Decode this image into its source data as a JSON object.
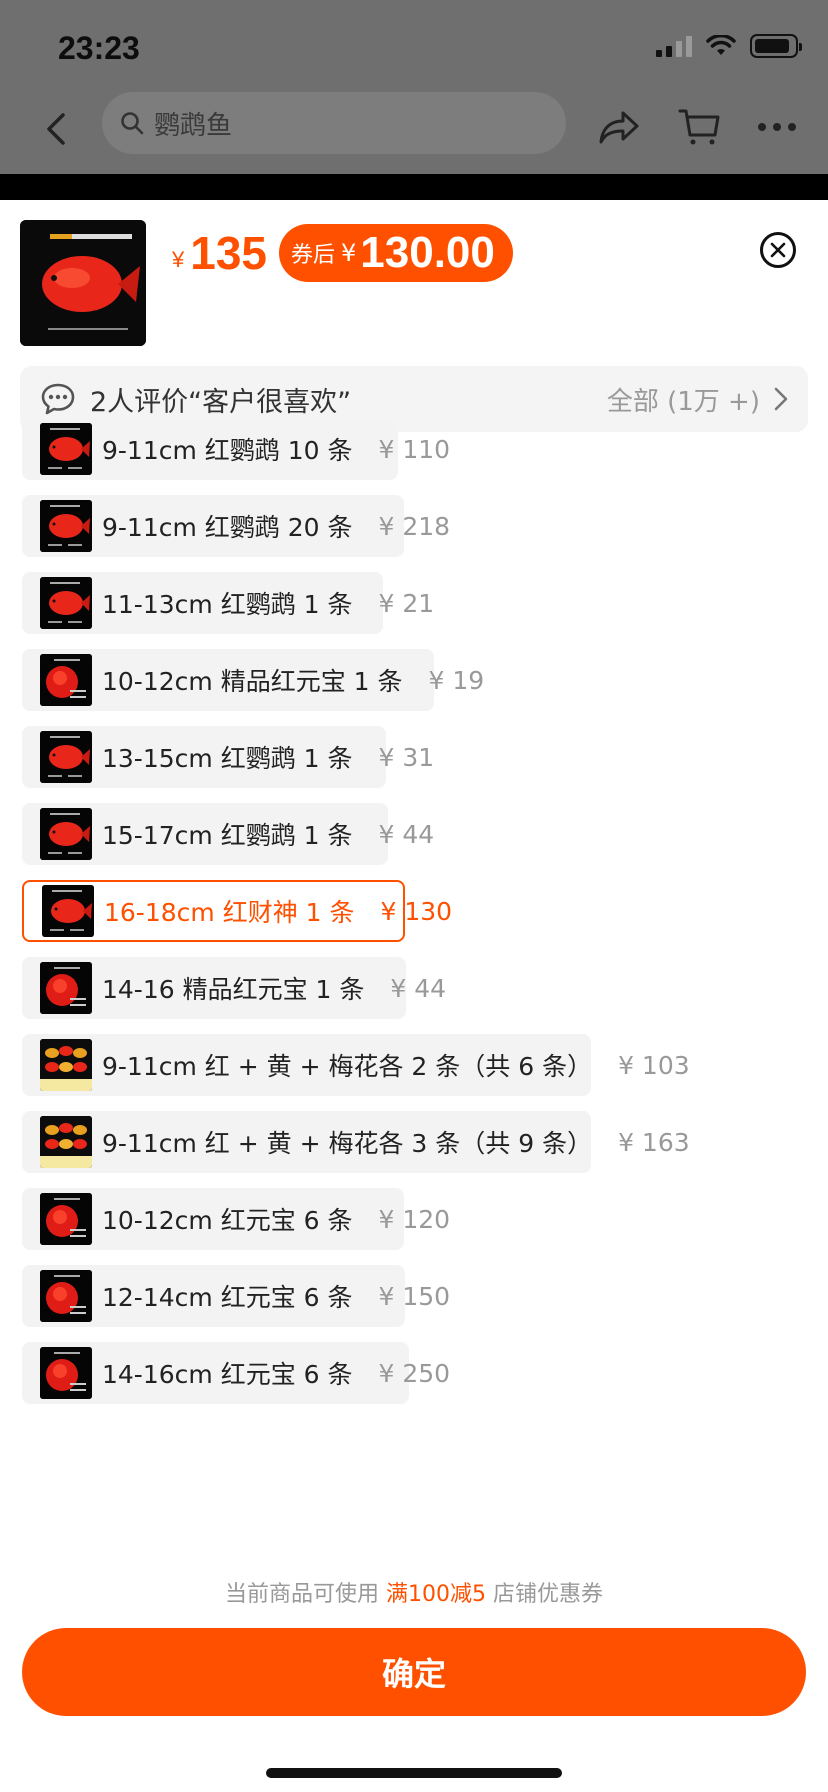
{
  "status_bar": {
    "time": "23:23"
  },
  "nav": {
    "search_text": "鹦鹉鱼"
  },
  "product": {
    "price_currency": "¥",
    "price": "135",
    "coupon_label": "券后",
    "coupon_currency": "¥",
    "coupon_price": "130.00"
  },
  "review": {
    "text": "2人评价“客户很喜欢”",
    "all": "全部 (1万 +)"
  },
  "options": [
    {
      "label": "9-11cm 红鹦鹉 10 条",
      "price": "¥ 110",
      "selected": false,
      "thumb": "fish"
    },
    {
      "label": "9-11cm 红鹦鹉 20 条",
      "price": "¥ 218",
      "selected": false,
      "thumb": "fish"
    },
    {
      "label": "11-13cm 红鹦鹉 1 条",
      "price": "¥ 21",
      "selected": false,
      "thumb": "fish"
    },
    {
      "label": "10-12cm 精品红元宝 1 条",
      "price": "¥ 19",
      "selected": false,
      "thumb": "yuanbao"
    },
    {
      "label": "13-15cm 红鹦鹉 1 条",
      "price": "¥ 31",
      "selected": false,
      "thumb": "fish"
    },
    {
      "label": "15-17cm 红鹦鹉 1 条",
      "price": "¥ 44",
      "selected": false,
      "thumb": "fish"
    },
    {
      "label": "16-18cm 红财神 1 条",
      "price": "¥ 130",
      "selected": true,
      "thumb": "fish"
    },
    {
      "label": "14-16 精品红元宝 1 条",
      "price": "¥ 44",
      "selected": false,
      "thumb": "yuanbao"
    },
    {
      "label": "9-11cm 红 + 黄 + 梅花各 2 条（共 6 条）",
      "price": "¥ 103",
      "selected": false,
      "thumb": "mix"
    },
    {
      "label": "9-11cm 红 + 黄 + 梅花各 3 条（共 9 条）",
      "price": "¥ 163",
      "selected": false,
      "thumb": "mix"
    },
    {
      "label": "10-12cm 红元宝 6 条",
      "price": "¥ 120",
      "selected": false,
      "thumb": "yuanbao"
    },
    {
      "label": "12-14cm 红元宝 6 条",
      "price": "¥ 150",
      "selected": false,
      "thumb": "yuanbao"
    },
    {
      "label": "14-16cm 红元宝 6 条",
      "price": "¥ 250",
      "selected": false,
      "thumb": "yuanbao"
    }
  ],
  "coupon_note": {
    "prefix": "当前商品可使用",
    "highlight": "满100减5",
    "suffix": "店铺优惠券"
  },
  "confirm_label": "确定",
  "colors": {
    "accent": "#ff5000"
  }
}
